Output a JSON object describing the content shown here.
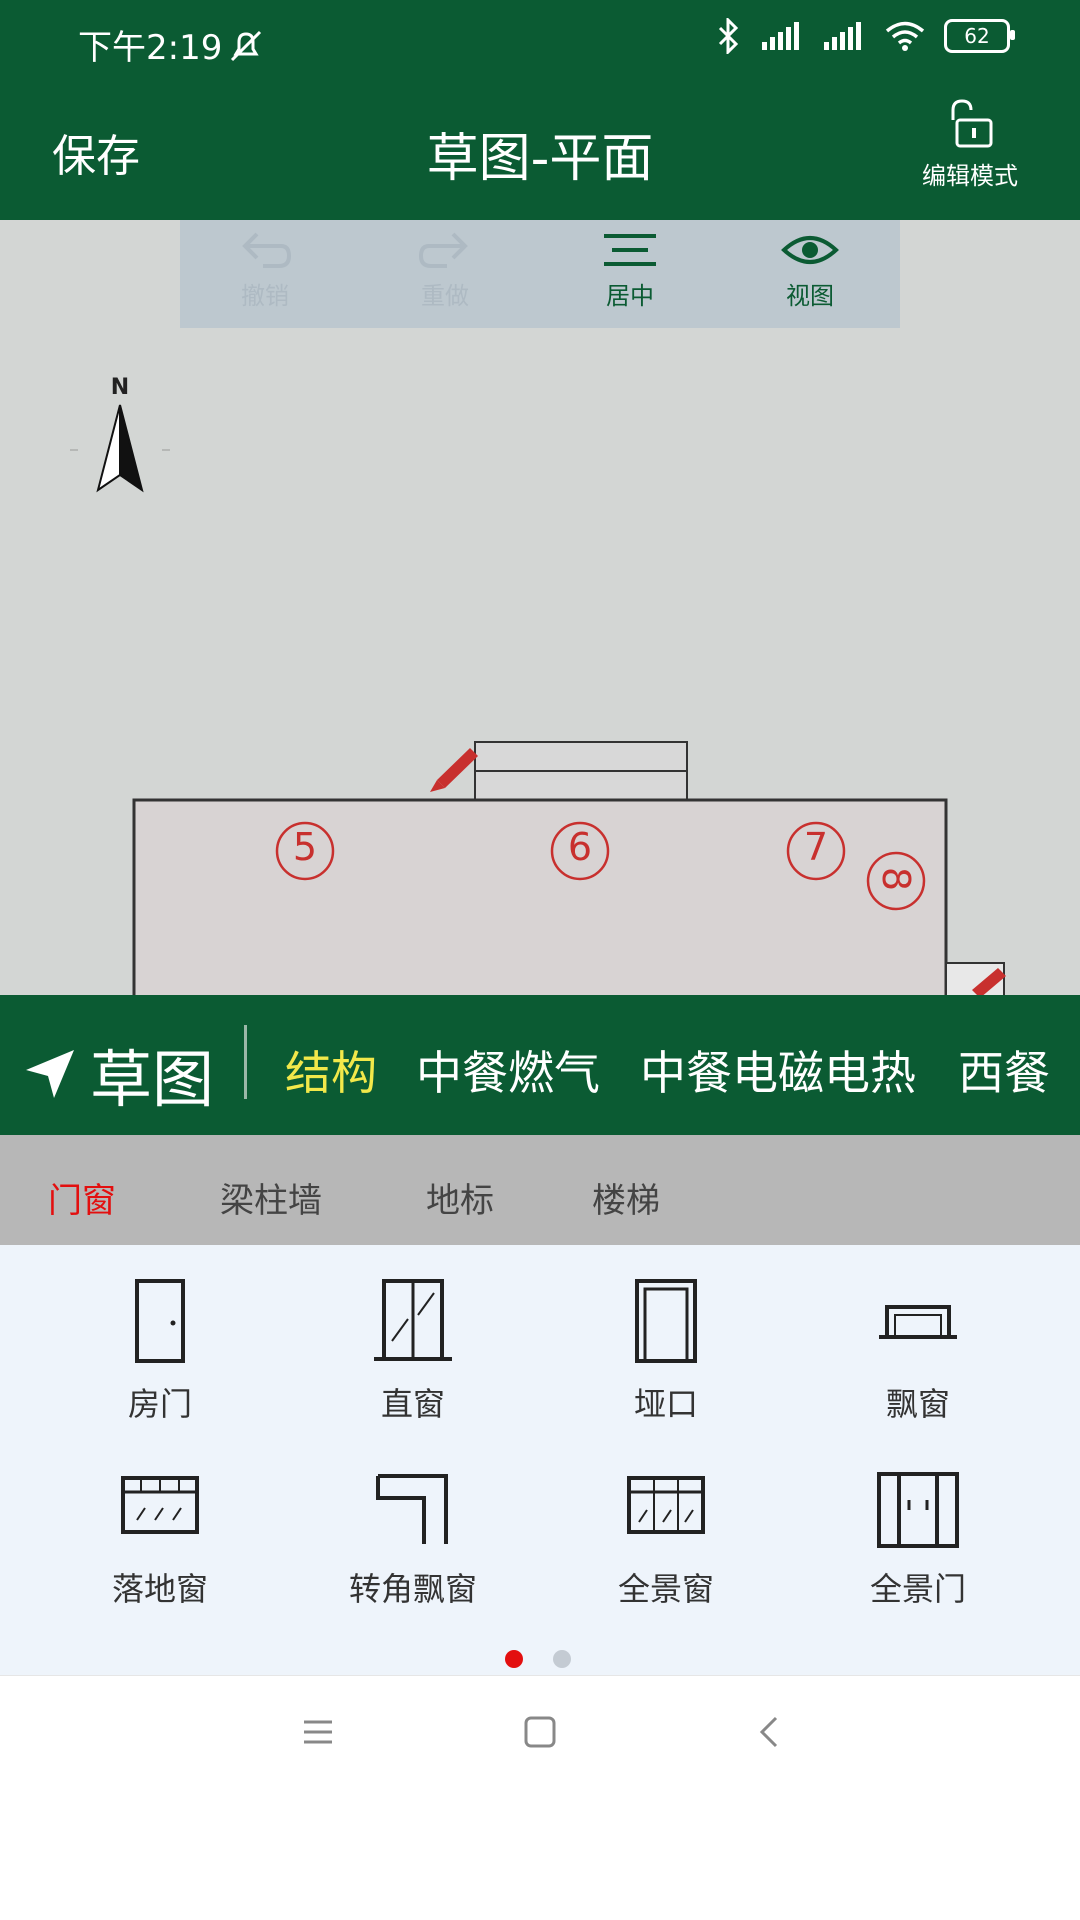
{
  "status": {
    "time": "下午2:19",
    "battery": "62"
  },
  "header": {
    "save": "保存",
    "title": "草图-平面",
    "edit_mode": "编辑模式"
  },
  "toolbar": {
    "undo": "撤销",
    "redo": "重做",
    "center": "居中",
    "view": "视图"
  },
  "compass": {
    "label": "N"
  },
  "plan": {
    "markers": [
      "5",
      "6",
      "7",
      "8"
    ]
  },
  "categories": {
    "main": "草图",
    "items": [
      "结构",
      "中餐燃气",
      "中餐电磁电热",
      "西餐"
    ]
  },
  "subtabs": [
    "门窗",
    "梁柱墙",
    "地标",
    "楼梯"
  ],
  "palette": [
    "房门",
    "直窗",
    "垭口",
    "飘窗",
    "落地窗",
    "转角飘窗",
    "全景窗",
    "全景门"
  ],
  "colors": {
    "primary": "#0b5b33",
    "accent_yellow": "#f2e84a",
    "accent_red": "#e30f0f"
  }
}
